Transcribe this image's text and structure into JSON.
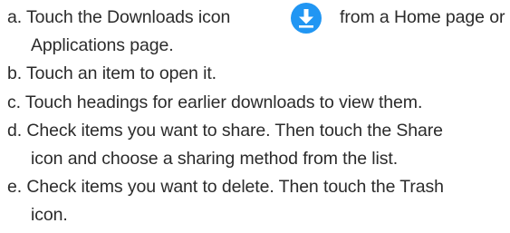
{
  "steps": [
    {
      "line1_before": "a. Touch the Downloads icon",
      "icon": "download-icon",
      "line1_after": "from a Home page or",
      "line2": "Applications page."
    },
    {
      "line1": "b. Touch an item to open it."
    },
    {
      "line1": "c. Touch headings for earlier downloads to view them."
    },
    {
      "line1": "d. Check items you want to share. Then touch the Share",
      "line2": "icon and choose a sharing method from the list."
    },
    {
      "line1": "e. Check items you want to delete. Then touch the Trash",
      "line2": "icon."
    }
  ],
  "colors": {
    "text": "#2b2b2b",
    "icon_background": "#2196f3",
    "icon_glyph": "#ffffff"
  }
}
